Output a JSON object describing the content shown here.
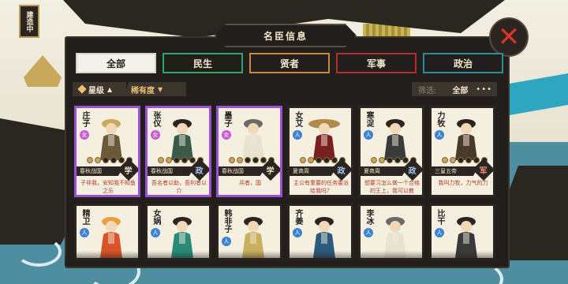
{
  "window": {
    "title": "名臣信息",
    "left_sign": "建造中"
  },
  "tabs": [
    {
      "label": "全部",
      "color": "#d8d4c8",
      "active": true
    },
    {
      "label": "民生",
      "color": "#2fa36b",
      "active": false
    },
    {
      "label": "贤者",
      "color": "#c9873a",
      "active": false
    },
    {
      "label": "军事",
      "color": "#b03030",
      "active": false
    },
    {
      "label": "政治",
      "color": "#2c8d9a",
      "active": false
    }
  ],
  "filters": {
    "star_sort_label": "星级",
    "star_sort_arrow": "▲",
    "rarity_sort_label": "稀有度",
    "rarity_sort_arrow": "▼",
    "filter_label": "筛选:",
    "filter_value": "全部",
    "more": "•••"
  },
  "ministers": [
    {
      "name": "庄子",
      "gender": "女",
      "gender_type": "f",
      "stars": 2,
      "era": "春秋战国",
      "category": "学",
      "category_type": "xue",
      "frame": "purple",
      "desc": "子非我，安知我不知鱼之乐",
      "robe": "#6b5a3a",
      "hat": "#c8a85a"
    },
    {
      "name": "张仪",
      "gender": "女",
      "gender_type": "f",
      "stars": 2,
      "era": "春秋战国",
      "category": "政",
      "category_type": "zheng",
      "frame": "purple",
      "desc": "吾名者以助，吾利者以介",
      "robe": "#3a5a4a",
      "hat": "#2b2420"
    },
    {
      "name": "墨子",
      "gender": "女",
      "gender_type": "f",
      "stars": 2,
      "era": "春秋战国",
      "category": "学",
      "category_type": "xue",
      "frame": "purple",
      "desc": "兵者，国",
      "robe": "#e8e2d0",
      "hat": "#6a6a6a"
    },
    {
      "name": "女艾",
      "gender": "人",
      "gender_type": "m",
      "stars": 2,
      "era": "夏商周",
      "category": "政",
      "category_type": "zheng",
      "frame": "plain",
      "desc": "主公有重要的任务委派给我吗？",
      "robe": "#7a1f1f",
      "hat": "#b08a4a"
    },
    {
      "name": "寒浞",
      "gender": "人",
      "gender_type": "m",
      "stars": 2,
      "era": "夏商周",
      "category": "政",
      "category_type": "zheng",
      "frame": "plain",
      "desc": "想要习怎么做一个合格的王上，我可以教",
      "robe": "#3a3a3a",
      "hat": "#2b2420"
    },
    {
      "name": "力牧",
      "gender": "人",
      "gender_type": "m",
      "stars": 2,
      "era": "三皇五帝",
      "category": "军",
      "category_type": "jun",
      "frame": "plain",
      "desc": "我叫力牧，力气的力",
      "robe": "#4a3a2a",
      "hat": "#2b2420"
    },
    {
      "name": "精卫",
      "gender": "人",
      "gender_type": "m",
      "frame": "plain",
      "robe": "#d9542a",
      "hat": "#e8a040"
    },
    {
      "name": "女娲",
      "gender": "人",
      "gender_type": "m",
      "frame": "plain",
      "robe": "#2a8a7a",
      "hat": "#2b2420"
    },
    {
      "name": "韩非子",
      "gender": "人",
      "gender_type": "m",
      "frame": "plain",
      "robe": "#c8b060",
      "hat": "#2b2420"
    },
    {
      "name": "齐姜",
      "gender": "人",
      "gender_type": "m",
      "frame": "plain",
      "robe": "#2c5a7a",
      "hat": "#2b2420"
    },
    {
      "name": "李冰",
      "gender": "人",
      "gender_type": "m",
      "frame": "plain",
      "robe": "#e8e2d0",
      "hat": "#6a6a6a"
    },
    {
      "name": "比干",
      "gender": "人",
      "gender_type": "m",
      "frame": "plain",
      "robe": "#3a3a3a",
      "hat": "#2b2420"
    }
  ]
}
